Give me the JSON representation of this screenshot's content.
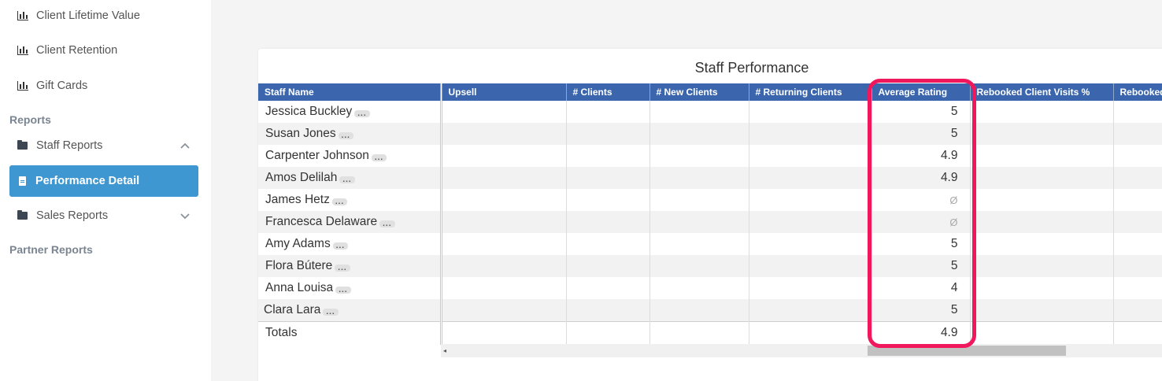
{
  "sidebar": {
    "links": [
      {
        "label": "Client Lifetime Value",
        "icon": "bar-chart-icon"
      },
      {
        "label": "Client Retention",
        "icon": "bar-chart-icon"
      },
      {
        "label": "Gift Cards",
        "icon": "bar-chart-icon"
      }
    ],
    "sections": {
      "reports": "Reports",
      "partner": "Partner Reports"
    },
    "staff_reports": {
      "label": "Staff Reports",
      "icon": "folder-icon",
      "chevron": "chevron-up-icon"
    },
    "active": {
      "label": "Performance Detail",
      "icon": "document-icon"
    },
    "sales_reports": {
      "label": "Sales Reports",
      "icon": "folder-icon",
      "chevron": "chevron-down-icon"
    }
  },
  "report": {
    "title": "Staff Performance",
    "columns": [
      "Staff Name",
      "Upsell",
      "# Clients",
      "# New Clients",
      "# Returning Clients",
      "Average Rating",
      "Rebooked Client Visits %",
      "Rebooked"
    ],
    "ellipsis": "...",
    "rows": [
      {
        "name": "Jessica Buckley",
        "rating": "5"
      },
      {
        "name": "Susan Jones",
        "rating": "5"
      },
      {
        "name": "Carpenter Johnson",
        "rating": "4.9"
      },
      {
        "name": "Amos Delilah",
        "rating": "4.9"
      },
      {
        "name": "James Hetz",
        "rating": "Ø"
      },
      {
        "name": "Francesca Delaware",
        "rating": "Ø"
      },
      {
        "name": "Amy Adams",
        "rating": "5"
      },
      {
        "name": "Flora Bútere",
        "rating": "5"
      },
      {
        "name": "Anna Louisa",
        "rating": "4"
      },
      {
        "name": "Clara Lara",
        "rating": "5"
      }
    ],
    "totals": {
      "label": "Totals",
      "rating": "4.9"
    },
    "scroll_left_arrow": "◂"
  },
  "colors": {
    "header_bg": "#3b66ad",
    "active_nav": "#3f97d2",
    "highlight": "#f0175c"
  }
}
